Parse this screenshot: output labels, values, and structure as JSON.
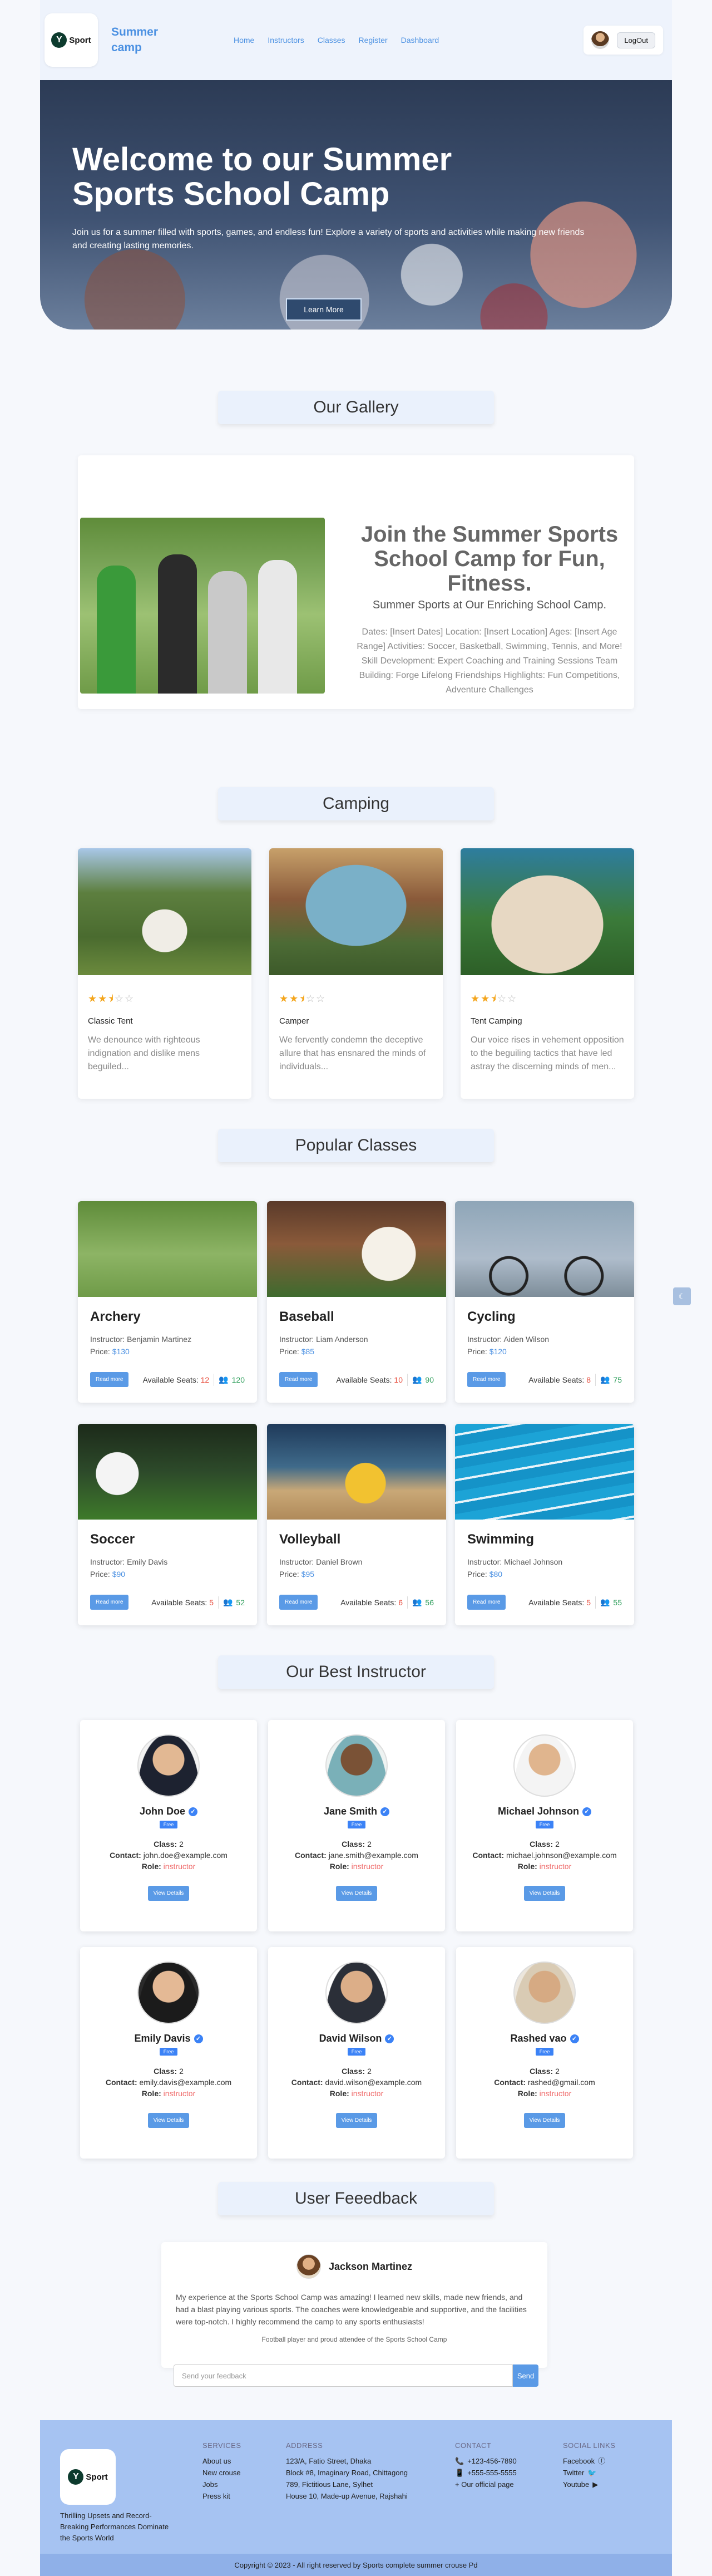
{
  "nav": {
    "brand": "Summer camp",
    "logo_text": "Sport",
    "links": [
      "Home",
      "Instructors",
      "Classes",
      "Register",
      "Dashboard"
    ],
    "logout": "LogOut"
  },
  "hero": {
    "title": "Welcome to our Summer Sports School Camp",
    "subtitle": "Join us for a summer filled with sports, games, and endless fun! Explore a variety of sports and activities while making new friends and creating lasting memories.",
    "button": "Learn More"
  },
  "gallery": {
    "title": "Our Gallery",
    "heading": "Join the Summer Sports School Camp for Fun, Fitness.",
    "subheading": "Summer Sports at Our Enriching School Camp.",
    "body": "Dates: [Insert Dates] Location: [Insert Location] Ages: [Insert Age Range] Activities: Soccer, Basketball, Swimming, Tennis, and More! Skill Development: Expert Coaching and Training Sessions Team Building: Forge Lifelong Friendships Highlights: Fun Competitions, Adventure Challenges"
  },
  "camping": {
    "title": "Camping",
    "cards": [
      {
        "category": "Classic Tent",
        "rating": 2.5,
        "desc": "We denounce with righteous indignation and dislike mens beguiled..."
      },
      {
        "category": "Camper",
        "rating": 2.5,
        "desc": "We fervently condemn the deceptive allure that has ensnared the minds of individuals..."
      },
      {
        "category": "Tent Camping",
        "rating": 2.5,
        "desc": "Our voice rises in vehement opposition to the beguiling tactics that have led astray the discerning minds of men..."
      }
    ]
  },
  "classes": {
    "title": "Popular Classes",
    "instructor_label": "Instructor:",
    "price_label": "Price:",
    "read_more": "Read more",
    "seats_label": "Available Seats:",
    "items": [
      {
        "name": "Archery",
        "instructor": "Benjamin Martinez",
        "price": "$130",
        "seats": "12",
        "students": "120"
      },
      {
        "name": "Baseball",
        "instructor": "Liam Anderson",
        "price": "$85",
        "seats": "10",
        "students": "90"
      },
      {
        "name": "Cycling",
        "instructor": "Aiden Wilson",
        "price": "$120",
        "seats": "8",
        "students": "75"
      },
      {
        "name": "Soccer",
        "instructor": "Emily Davis",
        "price": "$90",
        "seats": "5",
        "students": "52"
      },
      {
        "name": "Volleyball",
        "instructor": "Daniel Brown",
        "price": "$95",
        "seats": "6",
        "students": "56"
      },
      {
        "name": "Swimming",
        "instructor": "Michael Johnson",
        "price": "$80",
        "seats": "5",
        "students": "55"
      }
    ]
  },
  "instructors": {
    "title": "Our Best Instructor",
    "badge": "Free",
    "class_label": "Class:",
    "contact_label": "Contact:",
    "role_label": "Role:",
    "view_button": "View Details",
    "items": [
      {
        "name": "John Doe",
        "classes": "2",
        "contact": "john.doe@example.com",
        "role": "instructor"
      },
      {
        "name": "Jane Smith",
        "classes": "2",
        "contact": "jane.smith@example.com",
        "role": "instructor"
      },
      {
        "name": "Michael Johnson",
        "classes": "2",
        "contact": "michael.johnson@example.com",
        "role": "instructor"
      },
      {
        "name": "Emily Davis",
        "classes": "2",
        "contact": "emily.davis@example.com",
        "role": "instructor"
      },
      {
        "name": "David Wilson",
        "classes": "2",
        "contact": "david.wilson@example.com",
        "role": "instructor"
      },
      {
        "name": "Rashed vao",
        "classes": "2",
        "contact": "rashed@gmail.com",
        "role": "instructor"
      }
    ]
  },
  "feedback": {
    "title": "User Feeedback",
    "name": "Jackson Martinez",
    "text": "My experience at the Sports School Camp was amazing! I learned new skills, made new friends, and had a blast playing various sports. The coaches were knowledgeable and supportive, and the facilities were top-notch. I highly recommend the camp to any sports enthusiasts!",
    "sub": "Football player and proud attendee of the Sports School Camp",
    "placeholder": "Send your feedback",
    "send": "Send"
  },
  "footer": {
    "logo_text": "Sport",
    "tagline": "Thrilling Upsets and Record-Breaking Performances Dominate the Sports World",
    "services_title": "SERVICES",
    "services": [
      "About us",
      "New crouse",
      "Jobs",
      "Press kit"
    ],
    "address_title": "ADDRESS",
    "address": [
      "123/A, Fatio Street, Dhaka",
      "Block #8, Imaginary Road, Chittagong",
      "789, Fictitious Lane, Sylhet",
      "House 10, Made-up Avenue, Rajshahi"
    ],
    "contact_title": "CONTACT",
    "contact": [
      "+123-456-7890",
      "+555-555-5555",
      "+ Our official page"
    ],
    "social_title": "SOCIAL LINKS",
    "social": [
      "Facebook",
      "Twitter",
      "Youtube"
    ],
    "copyright": "Copyright © 2023 - All right reserved by Sports complete summer crouse Pd"
  },
  "colors": {
    "accent": "#4a90e2",
    "footer": "#a6c3f2",
    "star": "#f4a51c",
    "role": "#ef6a6a",
    "seats": "#e74c3c",
    "students": "#2e9e5b"
  }
}
